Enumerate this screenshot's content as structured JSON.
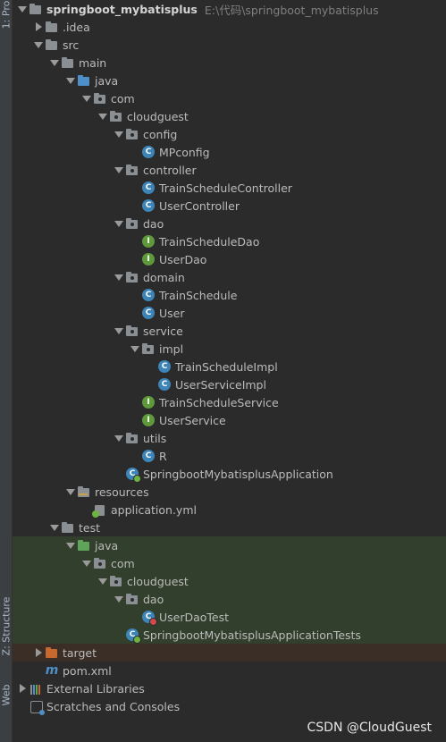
{
  "side_tabs": {
    "project": "1: Pro",
    "structure": "Z: Structure",
    "web": "Web"
  },
  "tree": [
    {
      "depth": 0,
      "arrow": "down",
      "icon": "module-folder",
      "text": "springboot_mybatisplus",
      "bold": true,
      "extra": "E:\\代码\\springboot_mybatisplus"
    },
    {
      "depth": 1,
      "arrow": "right",
      "icon": "folder",
      "text": ".idea"
    },
    {
      "depth": 1,
      "arrow": "down",
      "icon": "folder",
      "text": "src"
    },
    {
      "depth": 2,
      "arrow": "down",
      "icon": "folder",
      "text": "main"
    },
    {
      "depth": 3,
      "arrow": "down",
      "icon": "folder-blue",
      "text": "java"
    },
    {
      "depth": 4,
      "arrow": "down",
      "icon": "package",
      "text": "com"
    },
    {
      "depth": 5,
      "arrow": "down",
      "icon": "package",
      "text": "cloudguest"
    },
    {
      "depth": 6,
      "arrow": "down",
      "icon": "package",
      "text": "config"
    },
    {
      "depth": 7,
      "arrow": "none",
      "icon": "class",
      "text": "MPconfig"
    },
    {
      "depth": 6,
      "arrow": "down",
      "icon": "package",
      "text": "controller"
    },
    {
      "depth": 7,
      "arrow": "none",
      "icon": "class",
      "text": "TrainScheduleController"
    },
    {
      "depth": 7,
      "arrow": "none",
      "icon": "class",
      "text": "UserController"
    },
    {
      "depth": 6,
      "arrow": "down",
      "icon": "package",
      "text": "dao"
    },
    {
      "depth": 7,
      "arrow": "none",
      "icon": "interface",
      "text": "TrainScheduleDao"
    },
    {
      "depth": 7,
      "arrow": "none",
      "icon": "interface",
      "text": "UserDao"
    },
    {
      "depth": 6,
      "arrow": "down",
      "icon": "package",
      "text": "domain"
    },
    {
      "depth": 7,
      "arrow": "none",
      "icon": "class",
      "text": "TrainSchedule"
    },
    {
      "depth": 7,
      "arrow": "none",
      "icon": "class",
      "text": "User"
    },
    {
      "depth": 6,
      "arrow": "down",
      "icon": "package",
      "text": "service"
    },
    {
      "depth": 7,
      "arrow": "down",
      "icon": "package",
      "text": "impl"
    },
    {
      "depth": 8,
      "arrow": "none",
      "icon": "class",
      "text": "TrainScheduleImpl"
    },
    {
      "depth": 8,
      "arrow": "none",
      "icon": "class",
      "text": "UserServiceImpl"
    },
    {
      "depth": 7,
      "arrow": "none",
      "icon": "interface",
      "text": "TrainScheduleService"
    },
    {
      "depth": 7,
      "arrow": "none",
      "icon": "interface",
      "text": "UserService"
    },
    {
      "depth": 6,
      "arrow": "down",
      "icon": "package",
      "text": "utils"
    },
    {
      "depth": 7,
      "arrow": "none",
      "icon": "class",
      "text": "R"
    },
    {
      "depth": 6,
      "arrow": "none",
      "icon": "spring-class",
      "text": "SpringbootMybatisplusApplication"
    },
    {
      "depth": 3,
      "arrow": "down",
      "icon": "folder-resources",
      "text": "resources"
    },
    {
      "depth": 4,
      "arrow": "none",
      "icon": "yml",
      "text": "application.yml"
    },
    {
      "depth": 2,
      "arrow": "down",
      "icon": "folder",
      "text": "test",
      "hl": "green-end"
    },
    {
      "depth": 3,
      "arrow": "down",
      "icon": "folder-green",
      "text": "java",
      "hl": "green"
    },
    {
      "depth": 4,
      "arrow": "down",
      "icon": "package",
      "text": "com",
      "hl": "green"
    },
    {
      "depth": 5,
      "arrow": "down",
      "icon": "package",
      "text": "cloudguest",
      "hl": "green"
    },
    {
      "depth": 6,
      "arrow": "down",
      "icon": "package",
      "text": "dao",
      "hl": "green"
    },
    {
      "depth": 7,
      "arrow": "none",
      "icon": "test-class",
      "text": "UserDaoTest",
      "hl": "green"
    },
    {
      "depth": 6,
      "arrow": "none",
      "icon": "spring-class",
      "text": "SpringbootMybatisplusApplicationTests",
      "hl": "green"
    },
    {
      "depth": 1,
      "arrow": "right",
      "icon": "folder-orange",
      "text": "target",
      "hl": "brown"
    },
    {
      "depth": 1,
      "arrow": "none",
      "icon": "maven",
      "text": "pom.xml"
    },
    {
      "depth": 0,
      "arrow": "right",
      "icon": "libraries",
      "text": "External Libraries"
    },
    {
      "depth": 0,
      "arrow": "none",
      "icon": "scratches",
      "text": "Scratches and Consoles"
    }
  ],
  "watermark": "CSDN @CloudGuest"
}
